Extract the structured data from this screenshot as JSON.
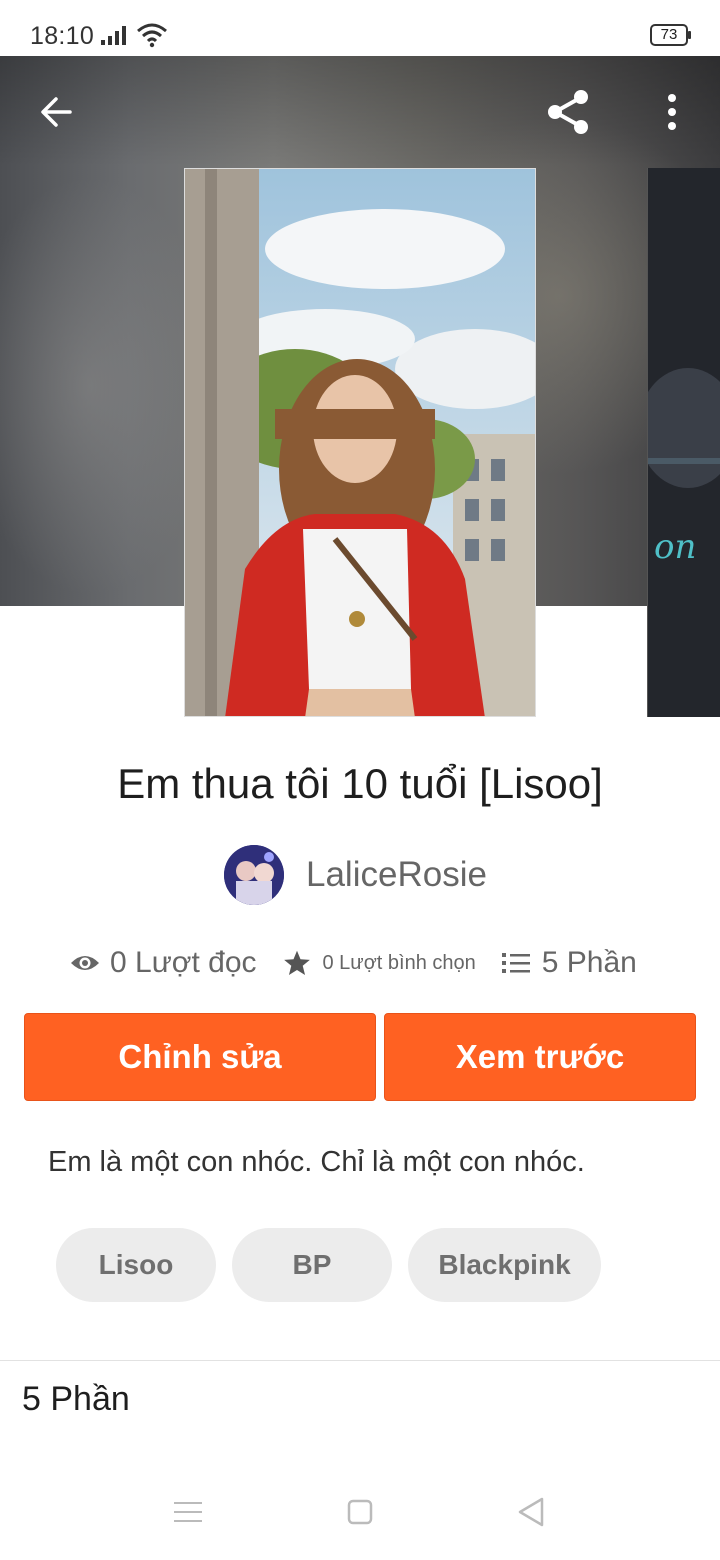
{
  "status_bar": {
    "time": "18:10",
    "battery": "73"
  },
  "story": {
    "title": "Em thua tôi 10 tuổi [Lisoo]",
    "author": "LaliceRosie",
    "stats": {
      "reads": "0 Lượt đọc",
      "votes": "0 Lượt bình chọn",
      "parts": "5 Phần"
    },
    "buttons": {
      "edit": "Chỉnh sửa",
      "preview": "Xem trước"
    },
    "description": "Em là một con nhóc. Chỉ là một con nhóc.",
    "tags": [
      "Lisoo",
      "BP",
      "Blackpink"
    ],
    "parts_heading": "5 Phần"
  },
  "colors": {
    "accent": "#ff6122",
    "tag_bg": "#ececec",
    "text_muted": "#666666"
  },
  "icons": [
    "back-arrow-icon",
    "share-icon",
    "more-vertical-icon",
    "eye-icon",
    "star-icon",
    "list-icon",
    "nav-menu-icon",
    "nav-home-icon",
    "nav-back-icon"
  ]
}
